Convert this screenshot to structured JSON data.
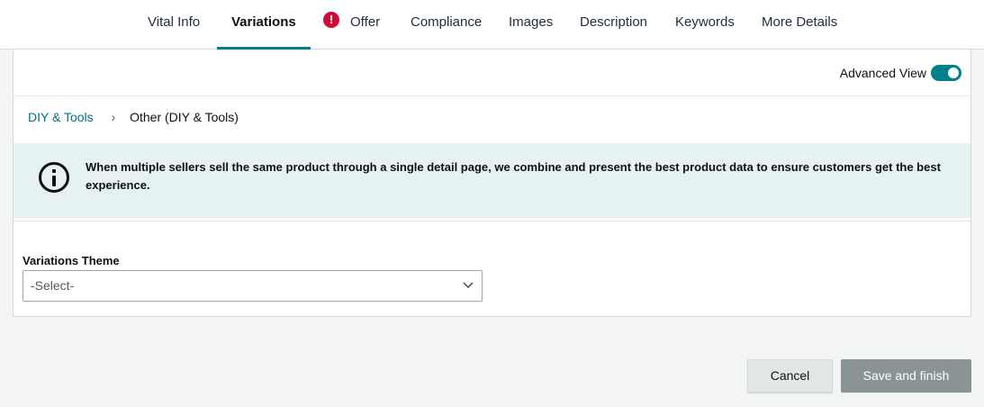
{
  "tabs": [
    {
      "label": "Vital Info"
    },
    {
      "label": "Variations",
      "active": true
    },
    {
      "label": "Offer",
      "alert": "!"
    },
    {
      "label": "Compliance"
    },
    {
      "label": "Images"
    },
    {
      "label": "Description"
    },
    {
      "label": "Keywords"
    },
    {
      "label": "More Details"
    }
  ],
  "advanced_view": {
    "label": "Advanced View",
    "enabled": true
  },
  "breadcrumb": {
    "category": "DIY & Tools",
    "separator": "›",
    "subcategory": "Other (DIY & Tools)"
  },
  "info": {
    "icon": "info-circle-icon",
    "message": "When multiple sellers sell the same product through a single detail page, we combine and present the best product data to ensure customers get the best experience."
  },
  "variations_theme": {
    "label": "Variations Theme",
    "selected": "-Select-"
  },
  "actions": {
    "cancel_label": "Cancel",
    "save_label": "Save and finish"
  },
  "colors": {
    "accent": "#00818a",
    "alert": "#cc0c39",
    "info_bg": "#e6f1f1",
    "disabled_button": "#8a9494"
  }
}
